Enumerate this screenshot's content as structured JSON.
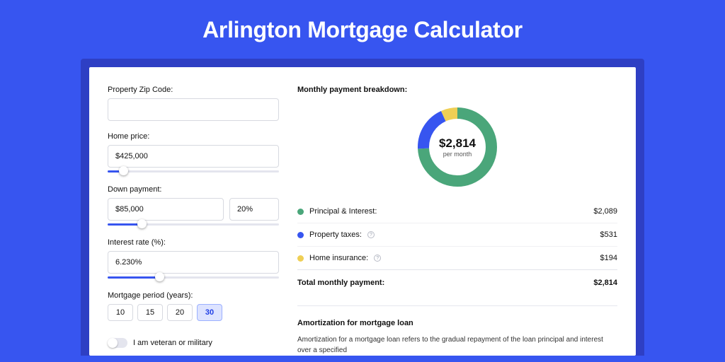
{
  "page": {
    "title": "Arlington Mortgage Calculator"
  },
  "form": {
    "zip_label": "Property Zip Code:",
    "zip_value": "",
    "home_price_label": "Home price:",
    "home_price_value": "$425,000",
    "home_price_slider_pct": 9,
    "down_label": "Down payment:",
    "down_amount": "$85,000",
    "down_pct": "20%",
    "down_slider_pct": 20,
    "rate_label": "Interest rate (%):",
    "rate_value": "6.230%",
    "rate_slider_pct": 30,
    "period_label": "Mortgage period (years):",
    "period_options": [
      "10",
      "15",
      "20",
      "30"
    ],
    "period_selected": "30",
    "vet_label": "I am veteran or military",
    "vet_on": false
  },
  "breakdown": {
    "title": "Monthly payment breakdown:",
    "center_amount": "$2,814",
    "center_sub": "per month",
    "items": [
      {
        "label": "Principal & Interest:",
        "value": "$2,089",
        "color": "#4aa67a",
        "pct": 0.742,
        "hint": false
      },
      {
        "label": "Property taxes:",
        "value": "$531",
        "color": "#3755f0",
        "pct": 0.189,
        "hint": true
      },
      {
        "label": "Home insurance:",
        "value": "$194",
        "color": "#efcf55",
        "pct": 0.069,
        "hint": true
      }
    ],
    "total_label": "Total monthly payment:",
    "total_value": "$2,814"
  },
  "amort": {
    "title": "Amortization for mortgage loan",
    "text": "Amortization for a mortgage loan refers to the gradual repayment of the loan principal and interest over a specified"
  },
  "colors": {
    "accent": "#3755f0"
  },
  "chart_data": {
    "type": "pie",
    "title": "Monthly payment breakdown",
    "series": [
      {
        "name": "Principal & Interest",
        "value": 2089,
        "color": "#4aa67a"
      },
      {
        "name": "Property taxes",
        "value": 531,
        "color": "#3755f0"
      },
      {
        "name": "Home insurance",
        "value": 194,
        "color": "#efcf55"
      }
    ],
    "total": 2814,
    "center_label": "$2,814 per month"
  }
}
